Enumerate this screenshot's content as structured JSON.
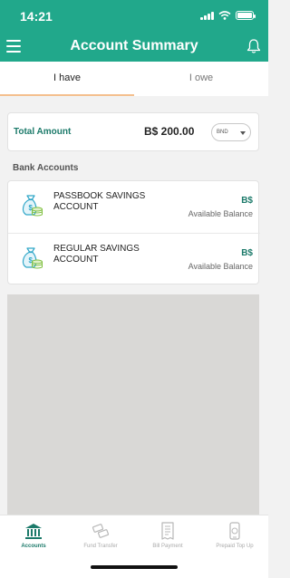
{
  "status_bar": {
    "time": "14:21"
  },
  "header": {
    "title": "Account Summary"
  },
  "tabs": [
    {
      "label": "I have",
      "active": true
    },
    {
      "label": "I owe",
      "active": false
    }
  ],
  "total": {
    "label": "Total Amount",
    "amount": "B$ 200.00",
    "currency": "BND"
  },
  "bank_section": {
    "title": "Bank Accounts"
  },
  "accounts": [
    {
      "name": "PASSBOOK SAVINGS ACCOUNT",
      "currency": "B$",
      "balance_label": "Available Balance"
    },
    {
      "name": "REGULAR SAVINGS ACCOUNT",
      "currency": "B$",
      "balance_label": "Available Balance"
    }
  ],
  "bottom_nav": [
    {
      "label": "Accounts",
      "icon": "bank-icon",
      "active": true
    },
    {
      "label": "Fund Transfer",
      "icon": "transfer-icon",
      "active": false
    },
    {
      "label": "Bill Payment",
      "icon": "bill-icon",
      "active": false
    },
    {
      "label": "Prepaid Top Up",
      "icon": "phone-topup-icon",
      "active": false
    }
  ],
  "colors": {
    "primary": "#21a88b",
    "accent_text": "#1c7a6a",
    "tab_underline": "#f4bf8e"
  }
}
